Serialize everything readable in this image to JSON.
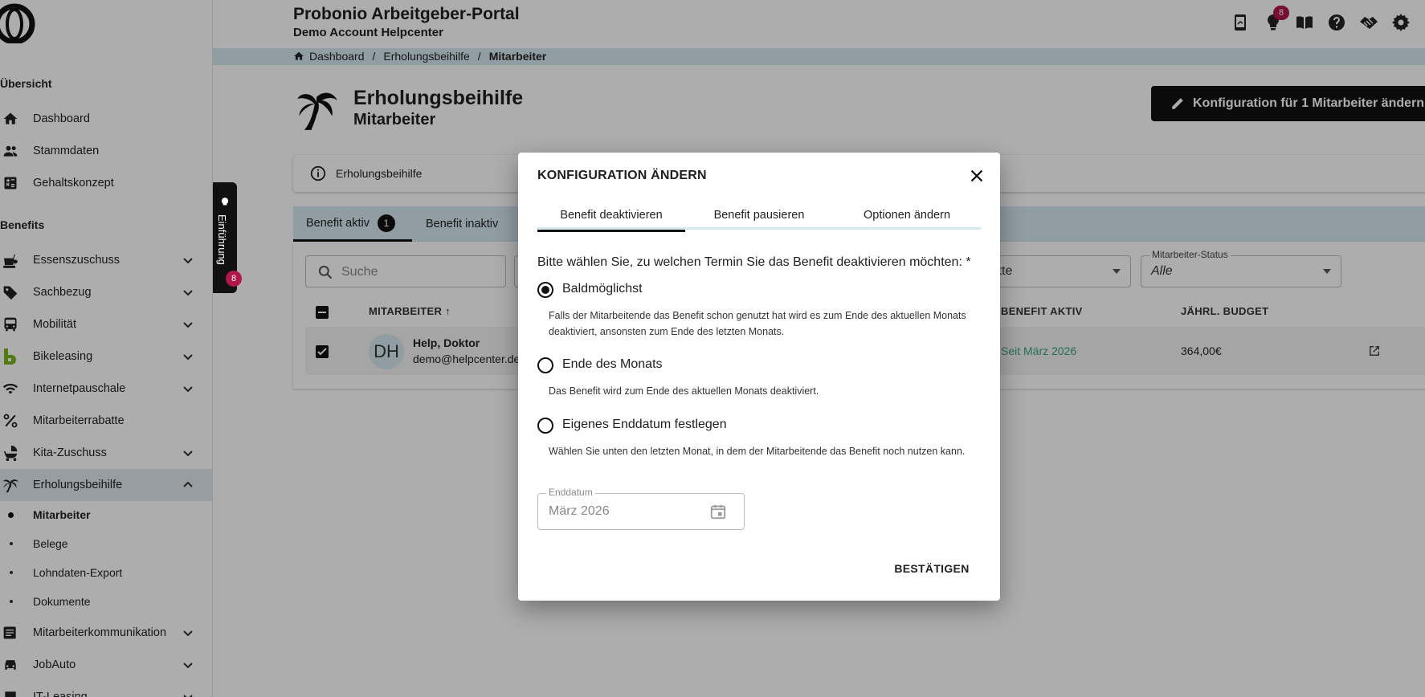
{
  "header": {
    "portal_title": "Probonio Arbeitgeber-Portal",
    "account": "Demo Account Helpcenter",
    "notification_count": "8"
  },
  "breadcrumb": [
    "Dashboard",
    "Erholungsbeihilfe",
    "Mitarbeiter"
  ],
  "sidebar": {
    "section_overview": "Übersicht",
    "overview_items": [
      {
        "label": "Dashboard",
        "icon": "home-icon"
      },
      {
        "label": "Stammdaten",
        "icon": "people-icon"
      },
      {
        "label": "Gehaltskonzept",
        "icon": "calculator-icon"
      }
    ],
    "section_benefits": "Benefits",
    "benefit_items": [
      {
        "label": "Essenszuschuss",
        "icon": "food-icon"
      },
      {
        "label": "Sachbezug",
        "icon": "tag-icon"
      },
      {
        "label": "Mobilität",
        "icon": "bus-icon"
      },
      {
        "label": "Bikeleasing",
        "icon": "bikeleasing-logo-icon"
      },
      {
        "label": "Internetpauschale",
        "icon": "wifi-icon"
      },
      {
        "label": "Mitarbeiterrabatte",
        "icon": "percent-icon"
      },
      {
        "label": "Kita-Zuschuss",
        "icon": "stroller-icon"
      },
      {
        "label": "Erholungsbeihilfe",
        "icon": "palm-icon"
      }
    ],
    "sub_items": [
      "Mitarbeiter",
      "Belege",
      "Lohndaten-Export",
      "Dokumente"
    ],
    "more_items": [
      {
        "label": "Mitarbeiterkommunikation",
        "icon": "news-icon"
      },
      {
        "label": "JobAuto",
        "icon": "car-icon"
      },
      {
        "label": "IT-Leasing",
        "icon": "laptop-icon"
      }
    ]
  },
  "intro_tab": {
    "label": "Einführung",
    "badge": "8"
  },
  "page": {
    "title": "Erholungsbeihilfe",
    "subtitle": "Mitarbeiter",
    "config_button": "Konfiguration für 1 Mitarbeiter ändern",
    "info_label": "Erholungsbeihilfe"
  },
  "tabs": {
    "active_label": "Benefit aktiv",
    "active_count": "1",
    "inactive_label": "Benefit inaktiv"
  },
  "filters": {
    "search_placeholder": "Suche",
    "partial_select_value": "itte",
    "status_label": "Mitarbeiter-Status",
    "status_value": "Alle"
  },
  "table": {
    "headers": {
      "employee": "MITARBEITER",
      "active": "BENEFIT AKTIV",
      "budget": "JÄHRL. BUDGET"
    },
    "rows": [
      {
        "initials": "DH",
        "name": "Help, Doktor",
        "email": "demo@helpcenter.de",
        "active": "Seit März 2026",
        "budget": "364,00€"
      }
    ]
  },
  "dialog": {
    "title": "KONFIGURATION ÄNDERN",
    "tabs": [
      "Benefit deaktivieren",
      "Benefit pausieren",
      "Optionen ändern"
    ],
    "question": "Bitte wählen Sie, zu welchen Termin Sie das Benefit deaktivieren möchten: *",
    "options": [
      {
        "label": "Baldmöglichst",
        "desc": "Falls der Mitarbeitende das Benefit schon genutzt hat wird es zum Ende des aktuellen Monats deaktiviert, ansonsten zum Ende des letzten Monats.",
        "selected": true
      },
      {
        "label": "Ende des Monats",
        "desc": "Das Benefit wird zum Ende des aktuellen Monats deaktiviert.",
        "selected": false
      },
      {
        "label": "Eigenes Enddatum festlegen",
        "desc": "Wählen Sie unten den letzten Monat, in dem der Mitarbeitende das Benefit noch nutzen kann.",
        "selected": false
      }
    ],
    "end_date_label": "Enddatum",
    "end_date_value": "März 2026",
    "confirm": "BESTÄTIGEN"
  },
  "colors": {
    "accent": "#111111",
    "highlight": "#d5e7f1",
    "badge": "#b0174a",
    "active_text": "#3aa17e"
  }
}
